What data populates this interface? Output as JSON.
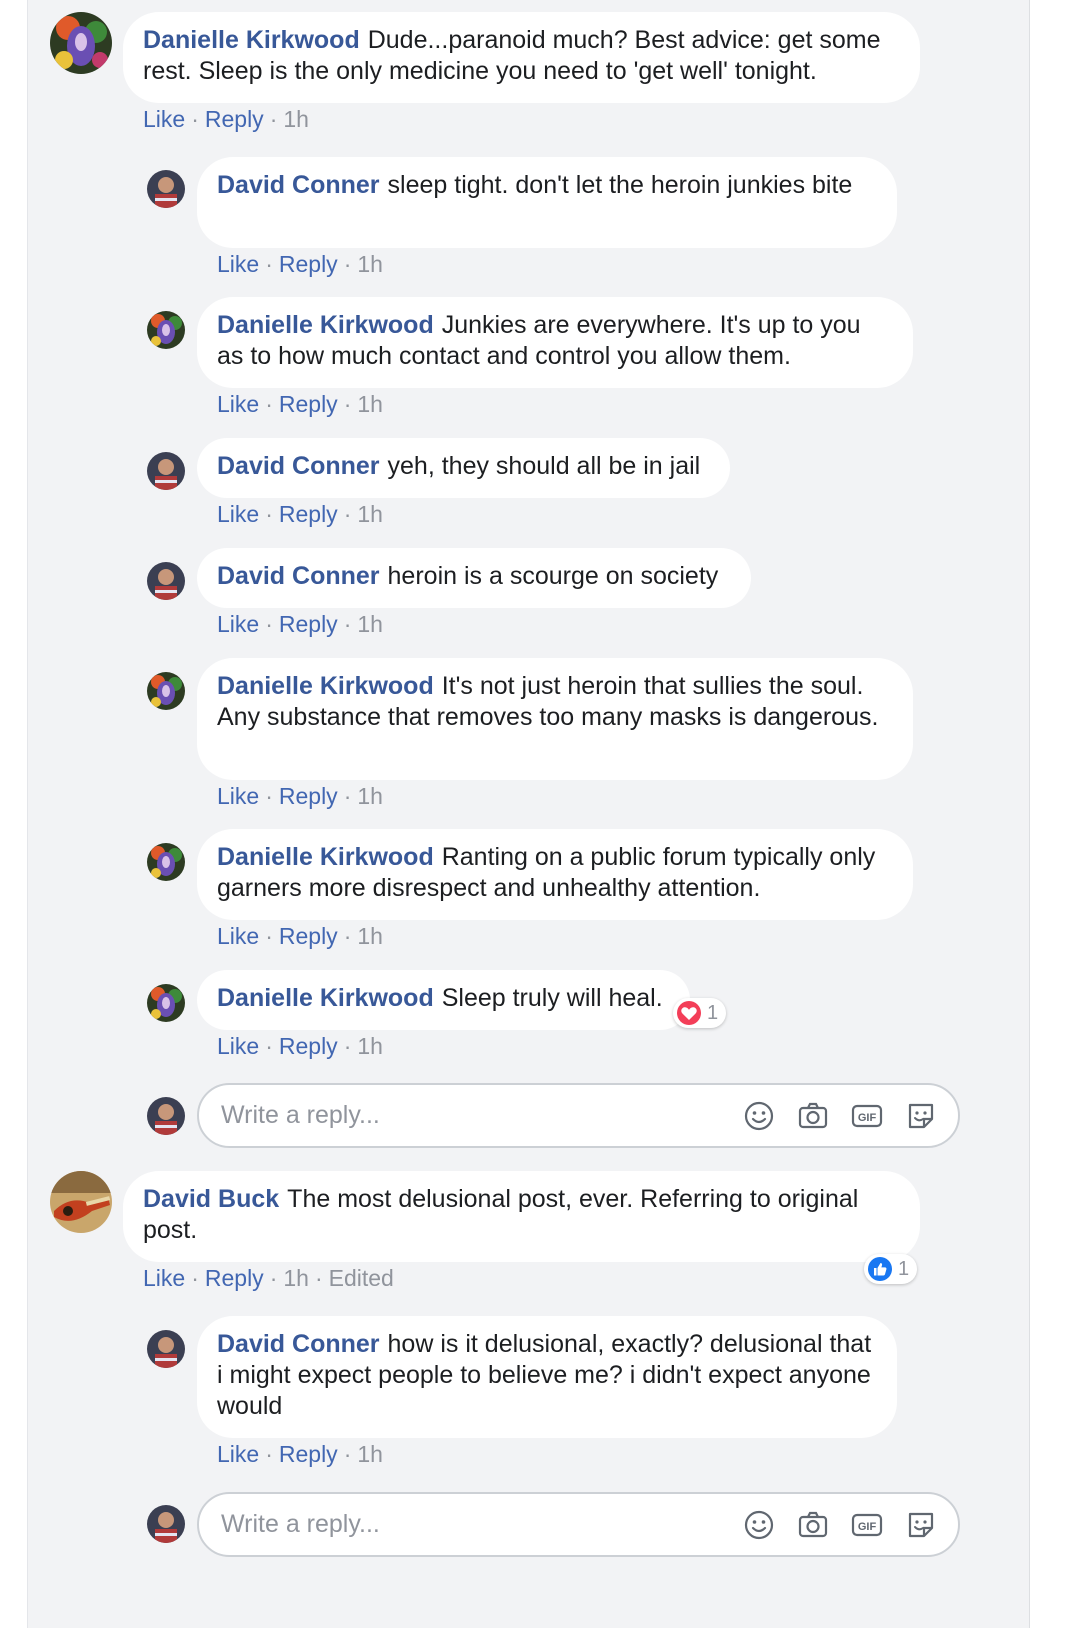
{
  "users": {
    "danielle": "Danielle Kirkwood",
    "david_conner": "David Conner",
    "david_buck": "David Buck"
  },
  "labels": {
    "like": "Like",
    "reply": "Reply",
    "edited": "Edited",
    "write_reply_placeholder": "Write a reply..."
  },
  "comments": [
    {
      "author": "Danielle Kirkwood",
      "text": "Dude...paranoid much? Best advice: get some rest. Sleep is the only medicine you need to 'get well' tonight.",
      "time": "1h"
    },
    {
      "author": "David Conner",
      "text": "sleep tight. don't let the heroin junkies bite",
      "time": "1h"
    },
    {
      "author": "Danielle Kirkwood",
      "text": "Junkies are everywhere. It's up to you as to how much contact and control you allow them.",
      "time": "1h"
    },
    {
      "author": "David Conner",
      "text": "yeh, they should all be in jail",
      "time": "1h"
    },
    {
      "author": "David Conner",
      "text": "heroin is a scourge on society",
      "time": "1h"
    },
    {
      "author": "Danielle Kirkwood",
      "text": "It's not just heroin that sullies the soul. Any substance that removes too many masks is dangerous.",
      "time": "1h"
    },
    {
      "author": "Danielle Kirkwood",
      "text": "Ranting on a public forum typically only garners more disrespect and unhealthy attention.",
      "time": "1h"
    },
    {
      "author": "Danielle Kirkwood",
      "text": "Sleep truly will heal.",
      "time": "1h",
      "reaction": {
        "type": "love-icon",
        "count": "1",
        "color": "#f33e58"
      }
    },
    {
      "author": "David Buck",
      "text": "The most delusional post, ever. Referring to original post.",
      "time": "1h",
      "reaction": {
        "type": "like-icon",
        "count": "1",
        "color": "#1877f2"
      }
    },
    {
      "author": "David Conner",
      "text": "how is it delusional, exactly? delusional that i might expect people to believe me? i didn't expect anyone would",
      "time": "1h"
    }
  ],
  "colors": {
    "name_link": "#385898",
    "action_link": "#4267b2",
    "meta_text": "#90949c",
    "panel_bg": "#f2f3f5"
  }
}
